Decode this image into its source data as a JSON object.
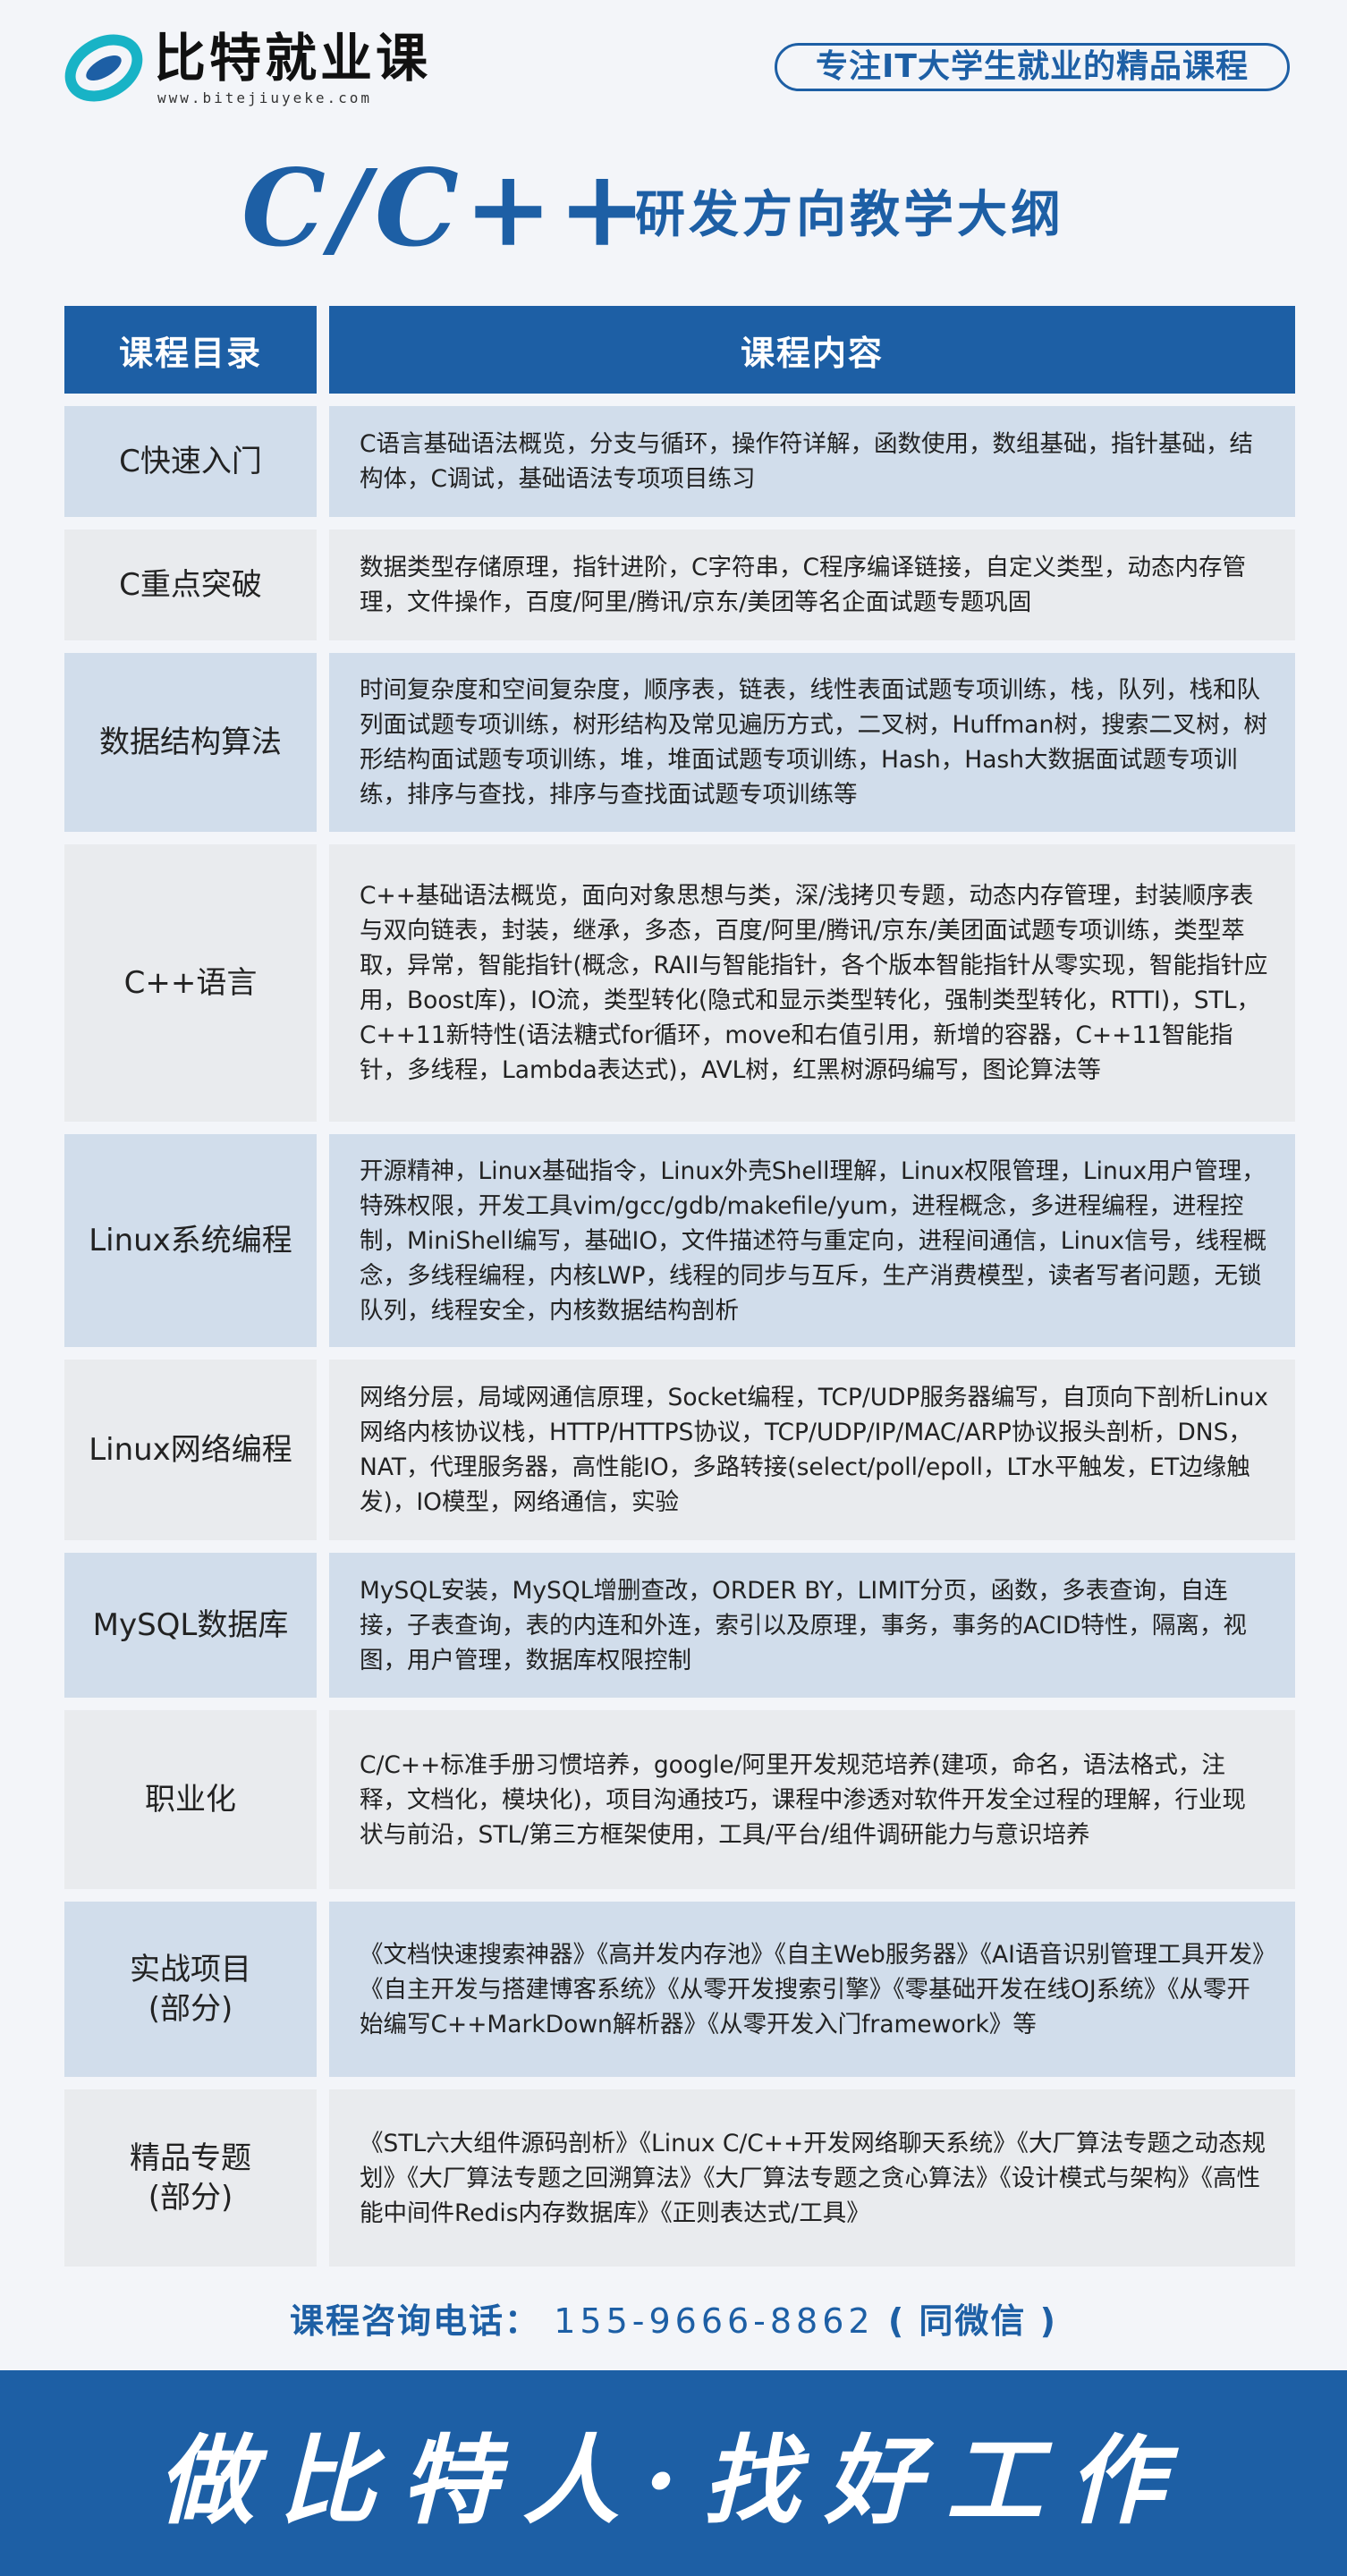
{
  "brand": {
    "name": "比特就业课",
    "url": "www.bitejiuyeke.com",
    "slogan": "专注IT大学生就业的精品课程",
    "primary_color": "#1d5fa5"
  },
  "title": {
    "main": "C/C++",
    "sub": "研发方向教学大纲"
  },
  "table": {
    "header_category": "课程目录",
    "header_content": "课程内容",
    "rows": [
      {
        "category": "C快速入门",
        "content": "C语言基础语法概览，分支与循环，操作符详解，函数使用，数组基础，指针基础，结构体，C调试，基础语法专项项目练习"
      },
      {
        "category": "C重点突破",
        "content": "数据类型存储原理，指针进阶，C字符串，C程序编译链接，自定义类型，动态内存管理，文件操作，百度/阿里/腾讯/京东/美团等名企面试题专题巩固"
      },
      {
        "category": "数据结构算法",
        "content": "时间复杂度和空间复杂度，顺序表，链表，线性表面试题专项训练，栈，队列，栈和队列面试题专项训练，树形结构及常见遍历方式，二叉树，Huffman树，搜索二叉树，树形结构面试题专项训练，堆，堆面试题专项训练，Hash，Hash大数据面试题专项训练，排序与查找，排序与查找面试题专项训练等"
      },
      {
        "category": "C++语言",
        "content": "C++基础语法概览，面向对象思想与类，深/浅拷贝专题，动态内存管理，封装顺序表与双向链表，封装，继承，多态，百度/阿里/腾讯/京东/美团面试题专项训练，类型萃取，异常，智能指针(概念，RAII与智能指针，各个版本智能指针从零实现，智能指针应用，Boost库)，IO流，类型转化(隐式和显示类型转化，强制类型转化，RTTI)，STL，C++11新特性(语法糖式for循环，move和右值引用，新增的容器，C++11智能指针，多线程，Lambda表达式)，AVL树，红黑树源码编写，图论算法等"
      },
      {
        "category": "Linux系统编程",
        "content": "开源精神，Linux基础指令，Linux外壳Shell理解，Linux权限管理，Linux用户管理，特殊权限，开发工具vim/gcc/gdb/makefile/yum，进程概念，多进程编程，进程控制，MiniShell编写，基础IO，文件描述符与重定向，进程间通信，Linux信号，线程概念，多线程编程，内核LWP，线程的同步与互斥，生产消费模型，读者写者问题，无锁队列，线程安全，内核数据结构剖析"
      },
      {
        "category": "Linux网络编程",
        "content": "网络分层，局域网通信原理，Socket编程，TCP/UDP服务器编写，自顶向下剖析Linux网络内核协议栈，HTTP/HTTPS协议，TCP/UDP/IP/MAC/ARP协议报头剖析，DNS，NAT，代理服务器，高性能IO，多路转接(select/poll/epoll，LT水平触发，ET边缘触发)，IO模型，网络通信，实验"
      },
      {
        "category": "MySQL数据库",
        "content": "MySQL安装，MySQL增删查改，ORDER BY，LIMIT分页，函数，多表查询，自连接，子表查询，表的内连和外连，索引以及原理，事务，事务的ACID特性，隔离，视图，用户管理，数据库权限控制"
      },
      {
        "category": "职业化",
        "content": "C/C++标准手册习惯培养，google/阿里开发规范培养(建项，命名，语法格式，注释，文档化，模块化)，项目沟通技巧，课程中渗透对软件开发全过程的理解，行业现状与前沿，STL/第三方框架使用，工具/平台/组件调研能力与意识培养"
      },
      {
        "category": "实战项目\n(部分)",
        "content": "《文档快速搜索神器》《高并发内存池》《自主Web服务器》《AI语音识别管理工具开发》《自主开发与搭建博客系统》《从零开发搜索引擎》《零基础开发在线OJ系统》《从零开始编写C++MarkDown解析器》《从零开发入门framework》等"
      },
      {
        "category": "精品专题\n(部分)",
        "content": "《STL六大组件源码剖析》《Linux C/C++开发网络聊天系统》《大厂算法专题之动态规划》《大厂算法专题之回溯算法》《大厂算法专题之贪心算法》《设计模式与架构》《高性能中间件Redis内存数据库》《正则表达式/工具》"
      }
    ]
  },
  "contact": {
    "label": "课程咨询电话：",
    "phone": "155-9666-8862",
    "note": "( 同微信 )"
  },
  "footer": {
    "slogan": "做比特人·找好工作"
  }
}
